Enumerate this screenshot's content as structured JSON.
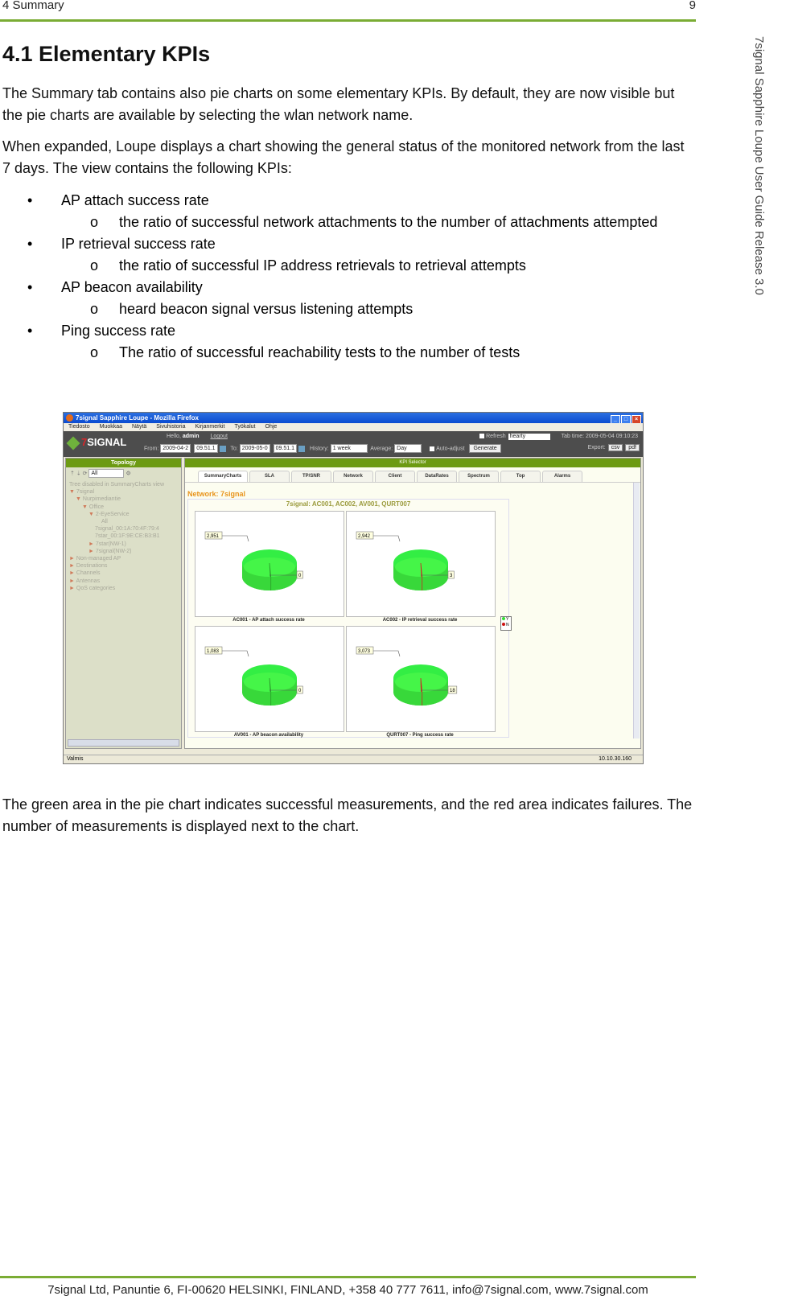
{
  "header": {
    "section": "4 Summary",
    "page_number": "9"
  },
  "side_title": "7signal Sapphire Loupe User Guide Release 3.0",
  "heading": "4.1 Elementary KPIs",
  "intro_paragraphs": [
    "The Summary tab contains also pie charts on some elementary KPIs. By default, they are now visible but the pie charts are available by selecting the wlan network name.",
    "When expanded, Loupe displays a chart showing the general status of the monitored network from the last 7 days. The view contains the following KPIs:"
  ],
  "kpi_list": [
    {
      "name": "AP attach success rate",
      "detail": "the ratio of successful network attachments to the number of attachments attempted"
    },
    {
      "name": "IP retrieval success rate",
      "detail": "the ratio of successful IP address retrievals to retrieval attempts"
    },
    {
      "name": "AP beacon availability",
      "detail": "heard beacon signal versus listening attempts"
    },
    {
      "name": "Ping success rate",
      "detail": "The ratio of successful reachability tests to the number of tests"
    }
  ],
  "bullet_glyph": "•",
  "sub_bullet_glyph": "o",
  "closing_paragraph": "The green area in the pie chart indicates successful measurements, and the red area indicates failures. The number of measurements is displayed next to the chart.",
  "footer": "7signal Ltd, Panuntie 6, FI-00620 HELSINKI, FINLAND, +358 40 777 7611, info@7signal.com, www.7signal.com",
  "screenshot": {
    "window_title": "7signal Sapphire Loupe - Mozilla Firefox",
    "window_buttons": [
      "_",
      "□",
      "×"
    ],
    "menu": [
      "Tiedosto",
      "Muokkaa",
      "Näytä",
      "Sivuhistoria",
      "Kirjanmerkit",
      "Työkalut",
      "Ohje"
    ],
    "logo_prefix": "7",
    "logo_text": "SIGNAL",
    "hello_label": "Hello,",
    "user": "admin",
    "logout": "Logout",
    "refresh_label": "Refresh",
    "refresh_value": "hearty",
    "tab_time": "Tab time: 2009-05-04 09:10:23",
    "from_label": "From:",
    "from_date": "2009-04-2",
    "from_time": "09.51.1",
    "to_label": "To:",
    "to_date": "2009-05-0",
    "to_time": "09.51.1",
    "history_label": "History:",
    "history_value": "1 week",
    "average_label": "Average:",
    "average_value": "Day",
    "auto_adjust": "Auto-adjust",
    "generate": "Generate",
    "export_label": "Export:",
    "export_buttons": [
      "csv",
      "pdf"
    ],
    "topology_title": "Topology",
    "topology_filter": "All",
    "tree": [
      {
        "label": "Tree disabled in SummaryCharts view",
        "indent": 0,
        "arrow": ""
      },
      {
        "label": "7signal",
        "indent": 0,
        "arrow": "▼"
      },
      {
        "label": "Nurpimediantie",
        "indent": 1,
        "arrow": "▼"
      },
      {
        "label": "Office",
        "indent": 2,
        "arrow": "▼"
      },
      {
        "label": "2-EyeService",
        "indent": 3,
        "arrow": "▼"
      },
      {
        "label": "All",
        "indent": 5,
        "arrow": ""
      },
      {
        "label": "7signal_00:1A:70:4F:79:4",
        "indent": 4,
        "arrow": ""
      },
      {
        "label": "7star_00:1F:9E:CE:B3:B1",
        "indent": 4,
        "arrow": ""
      },
      {
        "label": "7star(NW-1)",
        "indent": 3,
        "arrow": "►"
      },
      {
        "label": "7signal(NW-2)",
        "indent": 3,
        "arrow": "►"
      },
      {
        "label": "Non-managed AP",
        "indent": 0,
        "arrow": "►"
      },
      {
        "label": "Destinations",
        "indent": 0,
        "arrow": "►"
      },
      {
        "label": "Channels",
        "indent": 0,
        "arrow": "►"
      },
      {
        "label": "Antennas",
        "indent": 0,
        "arrow": "►"
      },
      {
        "label": "QoS categories",
        "indent": 0,
        "arrow": "►"
      }
    ],
    "kpi_selector": "KPI Selector",
    "tabs": [
      "SummaryCharts",
      "SLA",
      "TP/SNR",
      "Network",
      "Client",
      "DataRates",
      "Spectrum",
      "Top",
      "Alarms"
    ],
    "active_tab": 0,
    "network_label": "Network: 7signal",
    "chart_title": "7signal: AC001, AC002, AV001, QURT007",
    "legend": [
      {
        "label": "Y",
        "color": "#33dd33"
      },
      {
        "label": "N",
        "color": "#cc1111"
      }
    ],
    "status_left": "Valmis",
    "status_right": "10.10.30.160"
  },
  "chart_data": {
    "type": "pie",
    "title": "7signal: AC001, AC002, AV001, QURT007",
    "legend": [
      "Y",
      "N"
    ],
    "legend_position": "right",
    "colors": {
      "Y": "#44ee44",
      "N": "#cc2222"
    },
    "pies": [
      {
        "caption": "AC001 - AP attach success rate",
        "success": 2951,
        "success_label": "2,951",
        "failure": 0,
        "failure_label": "0"
      },
      {
        "caption": "AC002 - IP retrieval success rate",
        "success": 2942,
        "success_label": "2,942",
        "failure": 3,
        "failure_label": "3"
      },
      {
        "caption": "AV001 - AP beacon availability",
        "success": 1083,
        "success_label": "1,083",
        "failure": 0,
        "failure_label": "0"
      },
      {
        "caption": "QURT007 - Ping success rate",
        "success": 3073,
        "success_label": "3,073",
        "failure": 18,
        "failure_label": "18"
      }
    ]
  }
}
